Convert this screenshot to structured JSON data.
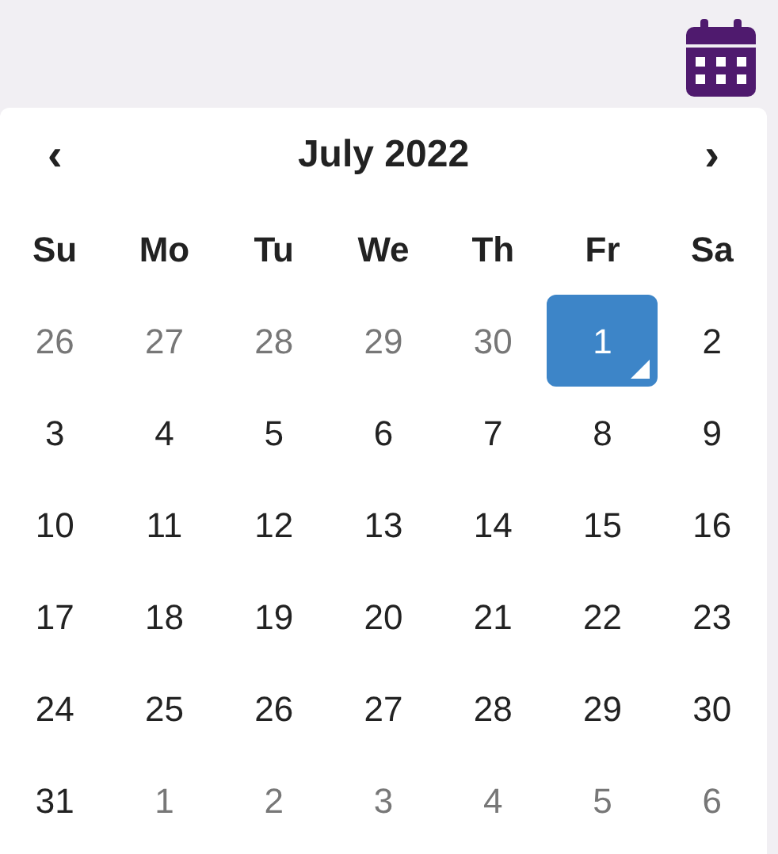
{
  "header": {
    "prev": "‹",
    "title": "July 2022",
    "next": "›"
  },
  "weekdays": [
    "Su",
    "Mo",
    "Tu",
    "We",
    "Th",
    "Fr",
    "Sa"
  ],
  "weeks": [
    [
      {
        "day": "26",
        "muted": true,
        "selected": false
      },
      {
        "day": "27",
        "muted": true,
        "selected": false
      },
      {
        "day": "28",
        "muted": true,
        "selected": false
      },
      {
        "day": "29",
        "muted": true,
        "selected": false
      },
      {
        "day": "30",
        "muted": true,
        "selected": false
      },
      {
        "day": "1",
        "muted": false,
        "selected": true
      },
      {
        "day": "2",
        "muted": false,
        "selected": false
      }
    ],
    [
      {
        "day": "3",
        "muted": false,
        "selected": false
      },
      {
        "day": "4",
        "muted": false,
        "selected": false
      },
      {
        "day": "5",
        "muted": false,
        "selected": false
      },
      {
        "day": "6",
        "muted": false,
        "selected": false
      },
      {
        "day": "7",
        "muted": false,
        "selected": false
      },
      {
        "day": "8",
        "muted": false,
        "selected": false
      },
      {
        "day": "9",
        "muted": false,
        "selected": false
      }
    ],
    [
      {
        "day": "10",
        "muted": false,
        "selected": false
      },
      {
        "day": "11",
        "muted": false,
        "selected": false
      },
      {
        "day": "12",
        "muted": false,
        "selected": false
      },
      {
        "day": "13",
        "muted": false,
        "selected": false
      },
      {
        "day": "14",
        "muted": false,
        "selected": false
      },
      {
        "day": "15",
        "muted": false,
        "selected": false
      },
      {
        "day": "16",
        "muted": false,
        "selected": false
      }
    ],
    [
      {
        "day": "17",
        "muted": false,
        "selected": false
      },
      {
        "day": "18",
        "muted": false,
        "selected": false
      },
      {
        "day": "19",
        "muted": false,
        "selected": false
      },
      {
        "day": "20",
        "muted": false,
        "selected": false
      },
      {
        "day": "21",
        "muted": false,
        "selected": false
      },
      {
        "day": "22",
        "muted": false,
        "selected": false
      },
      {
        "day": "23",
        "muted": false,
        "selected": false
      }
    ],
    [
      {
        "day": "24",
        "muted": false,
        "selected": false
      },
      {
        "day": "25",
        "muted": false,
        "selected": false
      },
      {
        "day": "26",
        "muted": false,
        "selected": false
      },
      {
        "day": "27",
        "muted": false,
        "selected": false
      },
      {
        "day": "28",
        "muted": false,
        "selected": false
      },
      {
        "day": "29",
        "muted": false,
        "selected": false
      },
      {
        "day": "30",
        "muted": false,
        "selected": false
      }
    ],
    [
      {
        "day": "31",
        "muted": false,
        "selected": false
      },
      {
        "day": "1",
        "muted": true,
        "selected": false
      },
      {
        "day": "2",
        "muted": true,
        "selected": false
      },
      {
        "day": "3",
        "muted": true,
        "selected": false
      },
      {
        "day": "4",
        "muted": true,
        "selected": false
      },
      {
        "day": "5",
        "muted": true,
        "selected": false
      },
      {
        "day": "6",
        "muted": true,
        "selected": false
      }
    ]
  ]
}
